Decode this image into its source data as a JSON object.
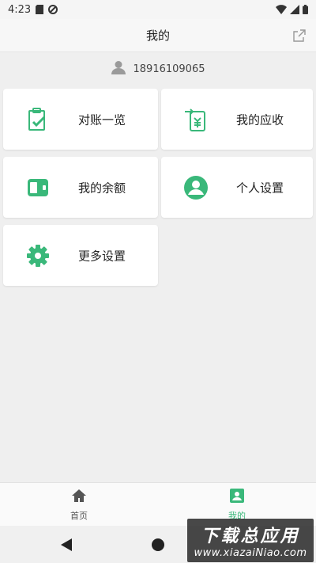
{
  "status": {
    "time": "4:23"
  },
  "header": {
    "title": "我的"
  },
  "user": {
    "phone": "18916109065"
  },
  "cards": [
    {
      "label": "对账一览",
      "icon": "clipboard-check-icon"
    },
    {
      "label": "我的应收",
      "icon": "receivable-transfer-icon"
    },
    {
      "label": "我的余额",
      "icon": "wallet-icon"
    },
    {
      "label": "个人设置",
      "icon": "user-circle-icon"
    },
    {
      "label": "更多设置",
      "icon": "gear-icon"
    }
  ],
  "bottom_nav": [
    {
      "label": "首页",
      "icon": "home-icon",
      "active": false
    },
    {
      "label": "我的",
      "icon": "profile-icon",
      "active": true
    }
  ],
  "watermark": {
    "title": "下载总应用",
    "url": "www.xiazaiNiao.com"
  },
  "colors": {
    "accent": "#3ab87a",
    "background": "#efefef"
  }
}
